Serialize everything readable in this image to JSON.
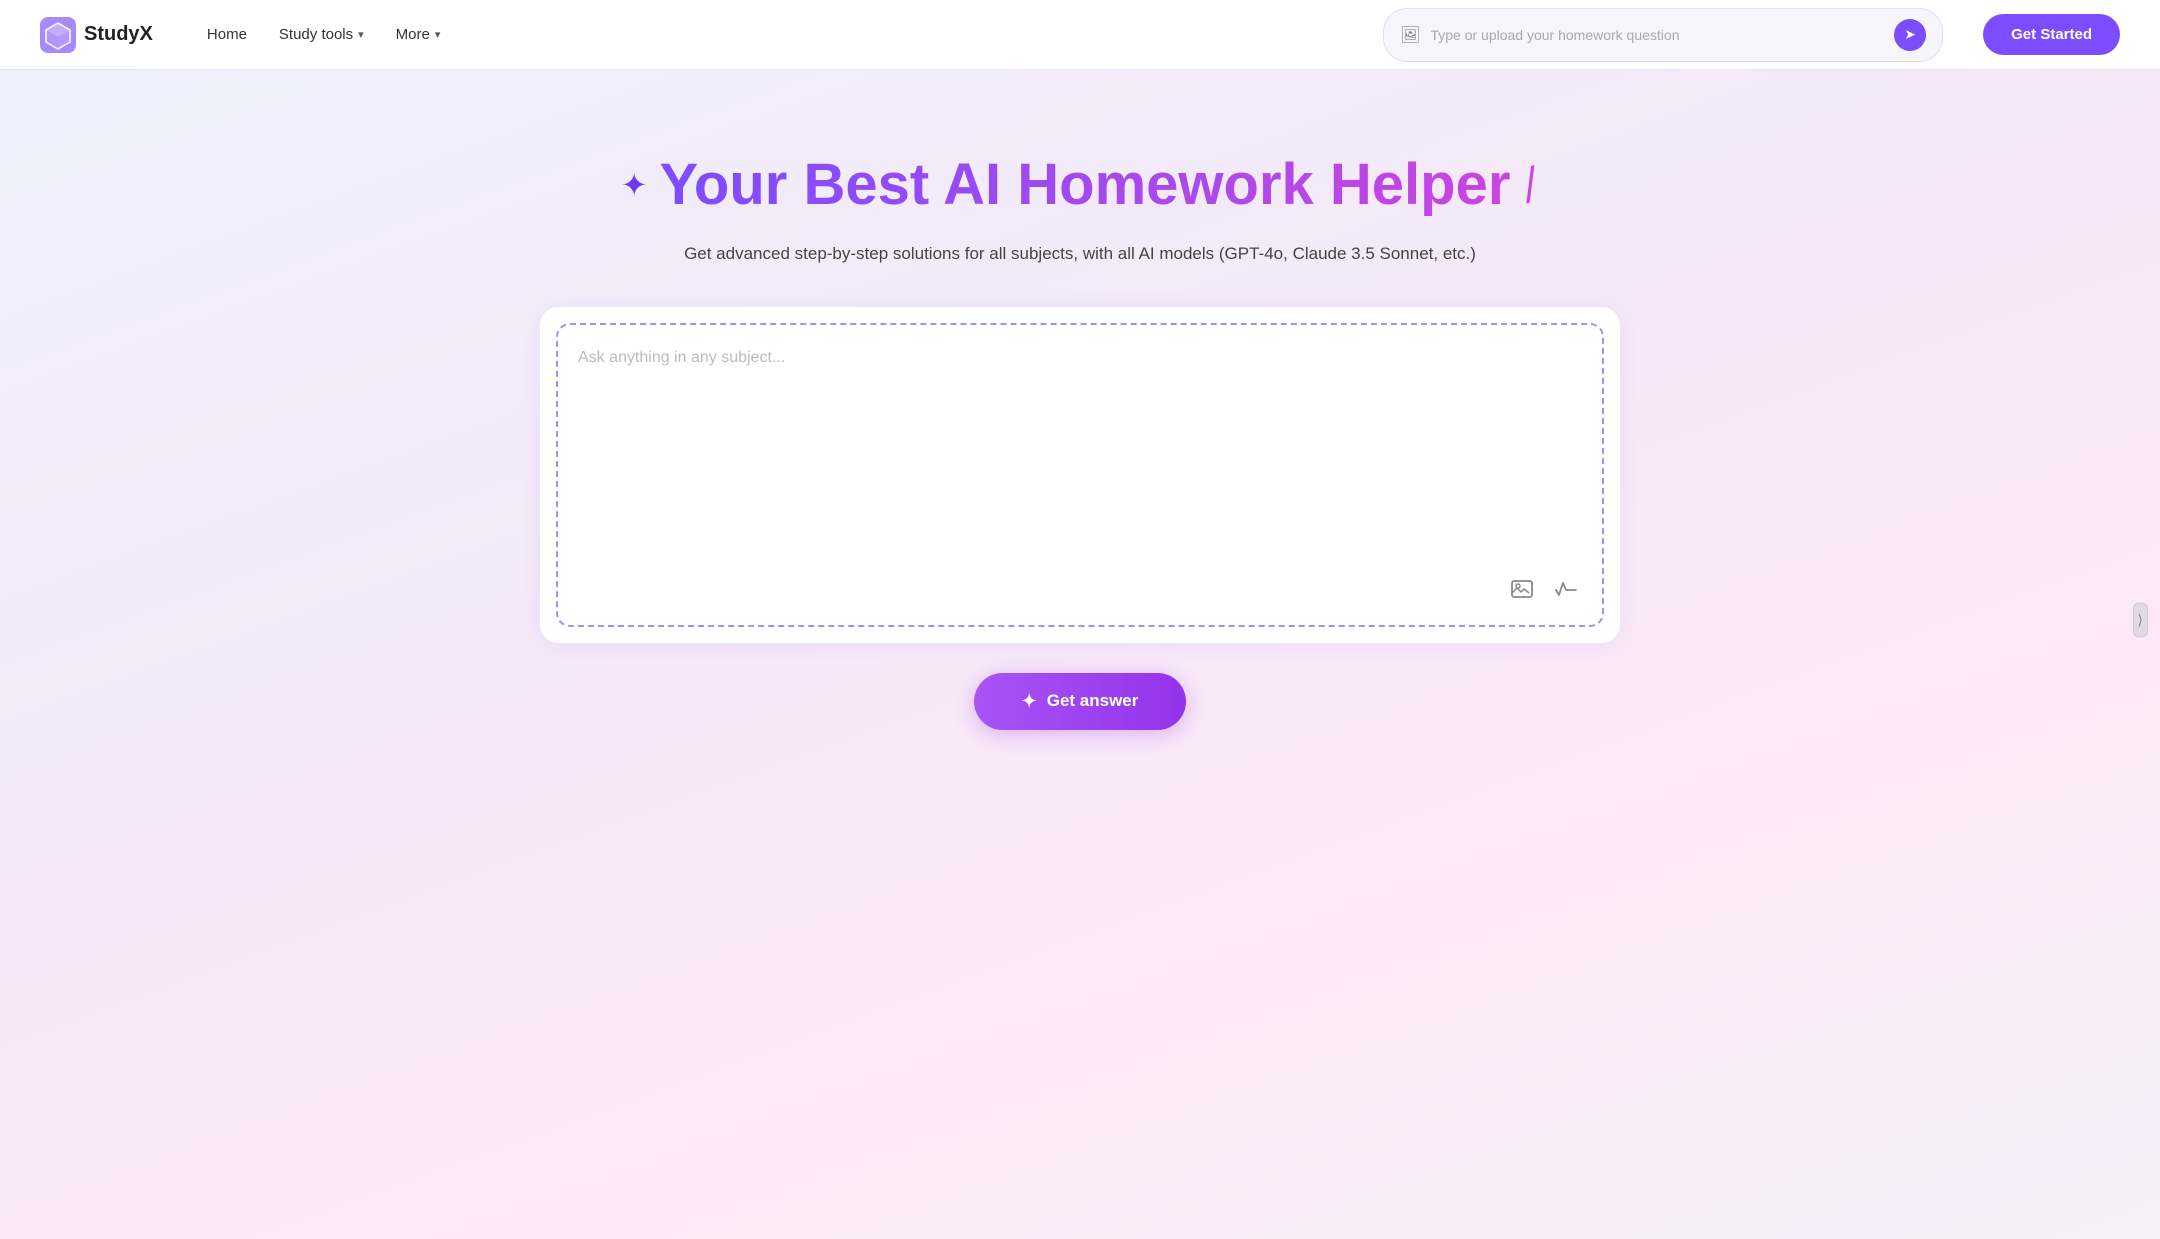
{
  "brand": {
    "name": "StudyX",
    "logo_text": "StudyX"
  },
  "navbar": {
    "home_label": "Home",
    "study_tools_label": "Study tools",
    "more_label": "More",
    "search_placeholder": "Type or upload your homework question",
    "get_started_label": "Get Started"
  },
  "hero": {
    "title": "Your Best AI Homework Helper",
    "subtitle": "Get advanced step-by-step solutions for all subjects, with all AI models (GPT-4o, Claude 3.5 Sonnet, etc.)",
    "input_placeholder": "Ask anything in any subject...",
    "get_answer_label": "Get answer",
    "image_upload_icon": "image-icon",
    "formula_icon": "formula-icon"
  }
}
